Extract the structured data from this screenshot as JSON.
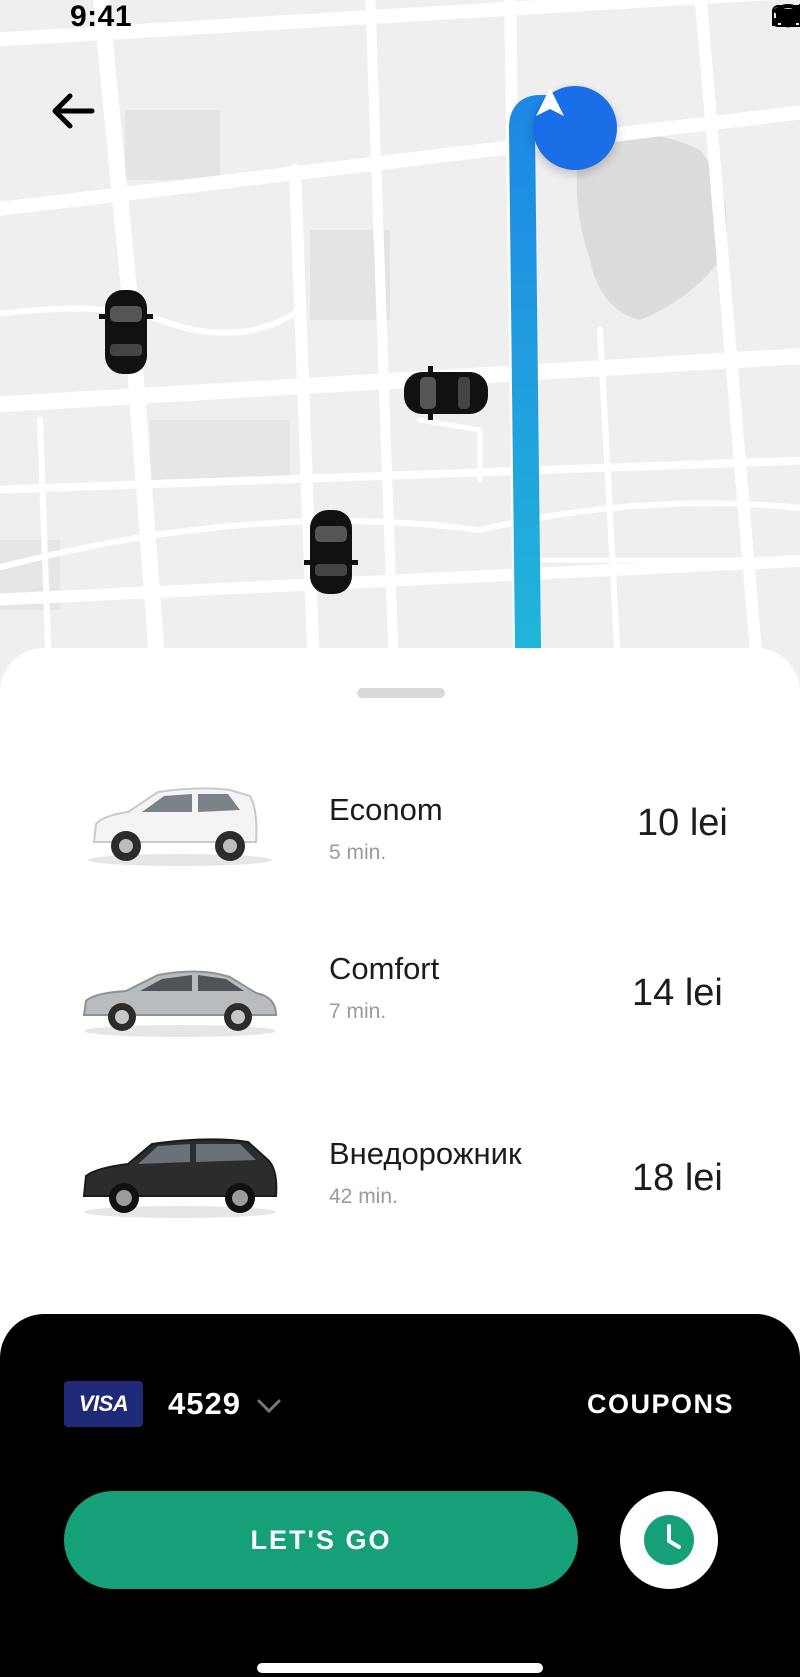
{
  "status_bar": {
    "time": "9:41"
  },
  "icons": {
    "back": "arrow-left-icon",
    "navigation": "navigation-arrow-icon",
    "card_chevron": "chevron-down-icon",
    "schedule": "clock-icon"
  },
  "rides": [
    {
      "name": "Econom",
      "eta": "5 min.",
      "price": "10 lei",
      "car_color": "white"
    },
    {
      "name": "Comfort",
      "eta": "7 min.",
      "price": "14 lei",
      "car_color": "silver"
    },
    {
      "name": "Внедорожник",
      "eta": "42 min.",
      "price": "18 lei",
      "car_color": "black"
    }
  ],
  "payment": {
    "card_brand": "VISA",
    "card_last4": "4529",
    "coupons_label": "COUPONS"
  },
  "actions": {
    "go_label": "LET'S GO"
  },
  "colors": {
    "primary_green": "#15a079",
    "route_blue": "#1ea7e1",
    "marker_blue": "#1a6ee8",
    "visa_blue": "#1e2a78"
  }
}
